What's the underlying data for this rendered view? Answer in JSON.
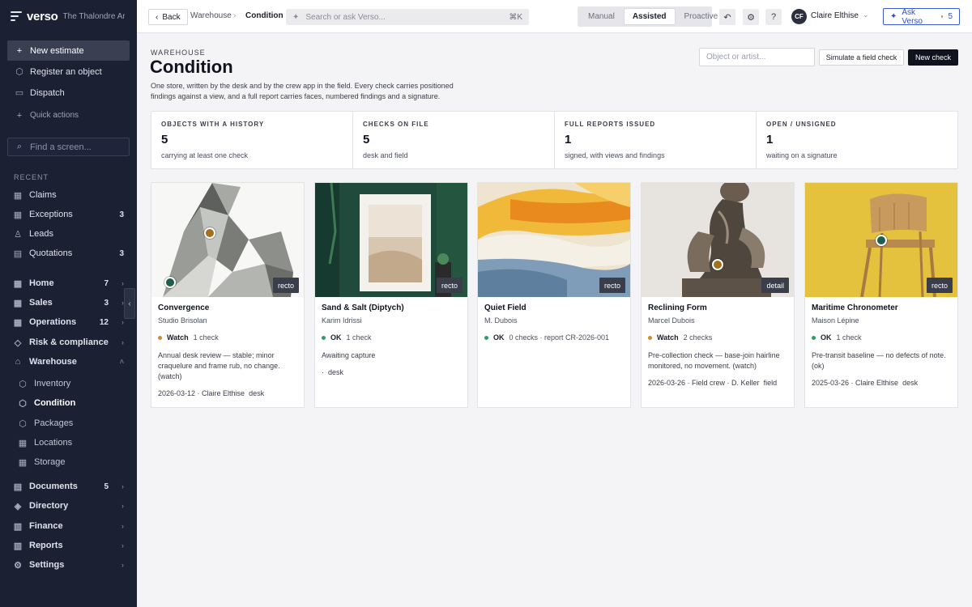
{
  "app": {
    "name": "verso",
    "org": "The Thalondre Archive"
  },
  "sidebar": {
    "new_estimate": "New estimate",
    "register_object": "Register an object",
    "dispatch": "Dispatch",
    "quick_actions": "Quick actions",
    "find_placeholder": "Find a screen...",
    "recent_heading": "RECENT",
    "recent": [
      {
        "label": "Claims",
        "count": ""
      },
      {
        "label": "Exceptions",
        "count": "3"
      },
      {
        "label": "Leads",
        "count": ""
      },
      {
        "label": "Quotations",
        "count": "3"
      }
    ],
    "groups": [
      {
        "label": "Home",
        "count": "7"
      },
      {
        "label": "Sales",
        "count": "3"
      },
      {
        "label": "Operations",
        "count": "12"
      },
      {
        "label": "Risk & compliance",
        "count": ""
      },
      {
        "label": "Warehouse",
        "count": ""
      }
    ],
    "warehouse_items": [
      "Inventory",
      "Condition",
      "Packages",
      "Locations",
      "Storage"
    ],
    "bottom_groups": [
      {
        "label": "Documents",
        "count": "5"
      },
      {
        "label": "Directory",
        "count": ""
      },
      {
        "label": "Finance",
        "count": ""
      },
      {
        "label": "Reports",
        "count": ""
      },
      {
        "label": "Settings",
        "count": ""
      }
    ]
  },
  "topbar": {
    "back": "Back",
    "crumb_parent": "Warehouse",
    "crumb_current": "Condition",
    "search_placeholder": "Search or ask Verso...",
    "search_shortcut": "⌘K",
    "modes": [
      "Manual",
      "Assisted",
      "Proactive"
    ],
    "active_mode": "Assisted",
    "user_initials": "CF",
    "user_name": "Claire Elthise",
    "ask_label": "Ask Verso",
    "ask_count": "5"
  },
  "page": {
    "eyebrow": "WAREHOUSE",
    "title": "Condition",
    "description": "One store, written by the desk and by the crew app in the field. Every check carries positioned findings against a view, and a full report carries faces, numbered findings and a signature.",
    "object_placeholder": "Object or artist...",
    "simulate_label": "Simulate a field check",
    "new_check_label": "New check"
  },
  "stats": [
    {
      "label": "OBJECTS WITH A HISTORY",
      "value": "5",
      "note": "carrying at least one check"
    },
    {
      "label": "CHECKS ON FILE",
      "value": "5",
      "note": "desk and field"
    },
    {
      "label": "FULL REPORTS ISSUED",
      "value": "1",
      "note": "signed, with views and findings"
    },
    {
      "label": "OPEN / UNSIGNED",
      "value": "1",
      "note": "waiting on a signature"
    }
  ],
  "cards": [
    {
      "title": "Convergence",
      "artist": "Studio Brisolan",
      "face": "recto",
      "status": "Watch",
      "status_color": "#d28a2a",
      "checks": "1 check",
      "text": "Annual desk review — stable; minor craquelure and frame rub, no change. (watch)",
      "meta": "2026-03-12 · Claire Elthise",
      "source": "desk"
    },
    {
      "title": "Sand & Salt (Diptych)",
      "artist": "Karim Idrissi",
      "face": "recto",
      "status": "OK",
      "status_color": "#2f9d6a",
      "checks": "1 check",
      "text": "Awaiting capture",
      "meta": "·",
      "source": "desk"
    },
    {
      "title": "Quiet Field",
      "artist": "M. Dubois",
      "face": "recto",
      "status": "OK",
      "status_color": "#2f9d6a",
      "checks": "0 checks · report CR-2026-001",
      "text": "",
      "meta": "",
      "source": ""
    },
    {
      "title": "Reclining Form",
      "artist": "Marcel Dubois",
      "face": "detail",
      "status": "Watch",
      "status_color": "#d28a2a",
      "checks": "2 checks",
      "text": "Pre-collection check — base-join hairline monitored, no movement. (watch)",
      "meta": "2026-03-26 · Field crew · D. Keller",
      "source": "field"
    },
    {
      "title": "Maritime Chronometer",
      "artist": "Maison Lépine",
      "face": "recto",
      "status": "OK",
      "status_color": "#2f9d6a",
      "checks": "1 check",
      "text": "Pre-transit baseline — no defects of note. (ok)",
      "meta": "2025-03-26 · Claire Elthise",
      "source": "desk"
    }
  ],
  "icons": {
    "back": "chevron-left-icon",
    "search": "sparkle-icon",
    "undo": "undo-icon",
    "settings": "gear-icon",
    "help": "help-icon",
    "ask": "sparkle-icon"
  }
}
